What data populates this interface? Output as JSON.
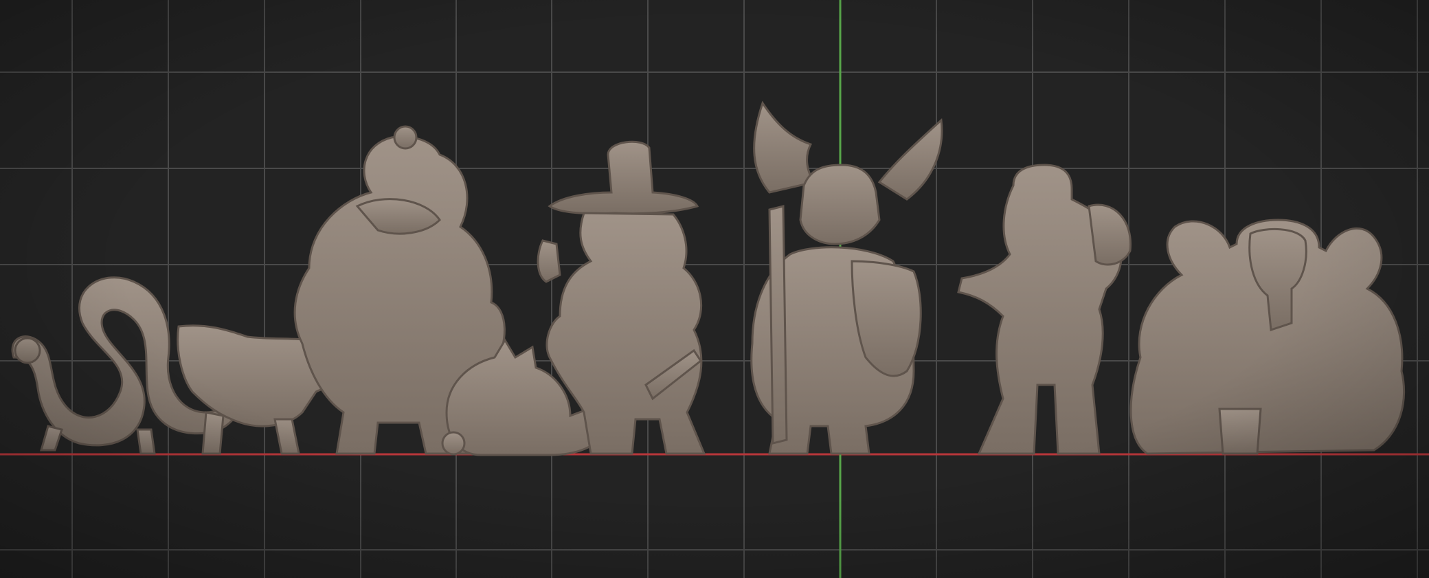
{
  "viewport": {
    "background_color": "#232323",
    "grid_color": "#4a4a4a",
    "ground_axis_color": "#b8363a",
    "vertical_axis_color": "#58a64a",
    "sculpt_color": "#8e8176"
  },
  "scene": {
    "figures": [
      {
        "name": "serpent",
        "icon": "snake-sculpt"
      },
      {
        "name": "crocodile",
        "icon": "crocodile-sculpt"
      },
      {
        "name": "hooded-crow",
        "icon": "crow-brute-sculpt"
      },
      {
        "name": "spiked-creature",
        "icon": "spiked-critter-sculpt"
      },
      {
        "name": "hat-gunslinger",
        "icon": "witch-hunter-sculpt"
      },
      {
        "name": "bat-helm-knight",
        "icon": "knight-sculpt"
      },
      {
        "name": "goblin",
        "icon": "goblin-sculpt"
      },
      {
        "name": "ram-skull-beast",
        "icon": "ram-skull-sculpt"
      }
    ]
  }
}
